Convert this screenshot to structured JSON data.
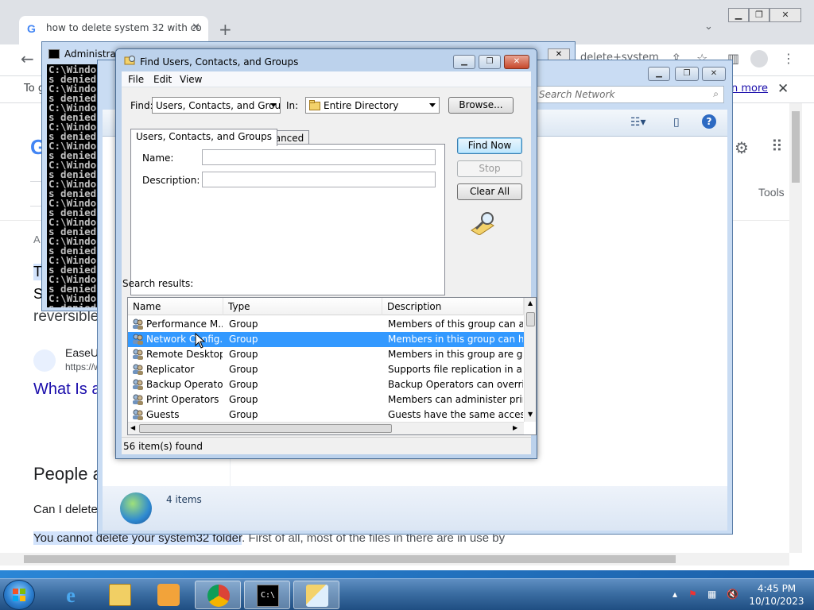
{
  "chrome": {
    "tab_title": "how to delete system 32 with co",
    "url_tail": "delete+system",
    "infobar_lead": "To g",
    "infobar_learn_more": "n more",
    "page": {
      "tools": "Tools",
      "letter_a": "A",
      "letter_t": "T",
      "letter_s": "S",
      "reversible": "reversible",
      "easeus": "EaseU",
      "easeus_url": "https://w",
      "what_is": "What Is a",
      "people_also": "People a",
      "can_i_delete": "Can I delete",
      "snippet_highlight": "You cannot delete your system32 folder",
      "snippet_rest": ". First of all, most of the files in there are in use by"
    }
  },
  "cmd": {
    "title": "Administrato",
    "lines": [
      "C:\\Windo",
      "s denied",
      "C:\\Windo",
      "s denied",
      "C:\\Windo",
      "s denied",
      "C:\\Windo",
      "s denied",
      "C:\\Windo",
      "s denied",
      "C:\\Windo",
      "s denied",
      "C:\\Windo",
      "s denied",
      "C:\\Windo",
      "s denied",
      "C:\\Windo",
      "s denied",
      "C:\\Windo",
      "s denied",
      "C:\\Windo",
      "s denied",
      "C:\\Windo",
      "s denied",
      "C:\\Windo",
      "s denied"
    ]
  },
  "network": {
    "search_placeholder": "Search Network",
    "items_count": "4 items"
  },
  "find": {
    "title": "Find Users, Contacts, and Groups",
    "menu": [
      "File",
      "Edit",
      "View"
    ],
    "find_label": "Find:",
    "find_value": "Users, Contacts, and Groups",
    "in_label": "In:",
    "in_value": "Entire Directory",
    "browse": "Browse...",
    "tabs": [
      "Users, Contacts, and Groups",
      "Advanced"
    ],
    "name_label": "Name:",
    "description_label": "Description:",
    "find_now": "Find Now",
    "stop": "Stop",
    "clear_all": "Clear All",
    "search_results": "Search results:",
    "columns": [
      "Name",
      "Type",
      "Description"
    ],
    "rows": [
      {
        "name": "Performance M...",
        "type": "Group",
        "desc": "Members of this group can acce"
      },
      {
        "name": "Network Config...",
        "type": "Group",
        "desc": "Members in this group can have"
      },
      {
        "name": "Remote Desktop...",
        "type": "Group",
        "desc": "Members in this group are grant"
      },
      {
        "name": "Replicator",
        "type": "Group",
        "desc": "Supports file replication in a dor"
      },
      {
        "name": "Backup Operators",
        "type": "Group",
        "desc": "Backup Operators can override s"
      },
      {
        "name": "Print Operators",
        "type": "Group",
        "desc": "Members can administer printer"
      },
      {
        "name": "Guests",
        "type": "Group",
        "desc": "Guests have the same access as"
      }
    ],
    "status": "56 item(s) found"
  },
  "taskbar": {
    "time": "4:45 PM",
    "date": "10/10/2023"
  },
  "colors": {
    "selection": "#3399ff",
    "link_blue": "#1a0dab",
    "highlight": "#d2e3fc"
  }
}
